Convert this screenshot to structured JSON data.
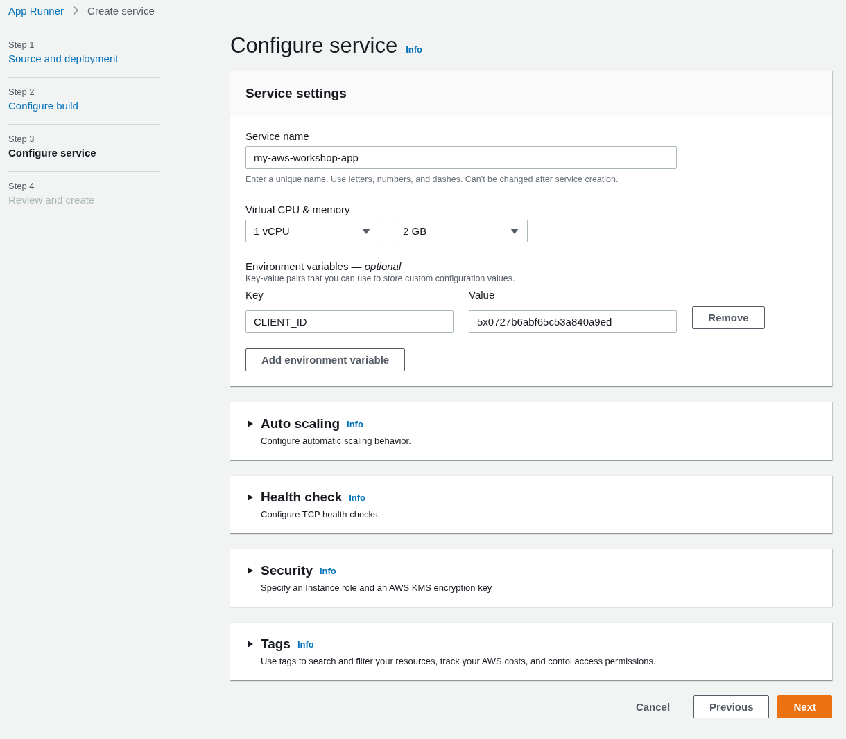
{
  "breadcrumb": [
    {
      "label": "App Runner",
      "kind": "link"
    },
    {
      "label": "Create service",
      "kind": "current"
    }
  ],
  "steps": [
    {
      "step": "Step 1",
      "label": "Source and deployment",
      "selected": false,
      "disabled": false
    },
    {
      "step": "Step 2",
      "label": "Configure build",
      "selected": false,
      "disabled": false
    },
    {
      "step": "Step 3",
      "label": "Configure service",
      "selected": true,
      "disabled": false
    },
    {
      "step": "Step 4",
      "label": "Review and create",
      "selected": false,
      "disabled": true
    }
  ],
  "page_title": "Configure service",
  "page_info": "Info",
  "service_settings": {
    "title": "Service settings",
    "service_name": {
      "label": "Service name",
      "value": "my-aws-workshop-app",
      "hint": "Enter a unique name. Use letters, numbers, and dashes. Can't be changed after service creation."
    },
    "cpu_memory": {
      "label": "Virtual CPU & memory",
      "cpu": "1 vCPU",
      "memory": "2 GB"
    },
    "env": {
      "label": "Environment variables — *optional*",
      "description": "Key-value pairs that you can use to store custom configuration values.",
      "key_label": "Key",
      "value_label": "Value",
      "rows": [
        {
          "key": "CLIENT_ID",
          "value": "5x0727b6abf65c53a840a9ed",
          "remove": "Remove"
        }
      ],
      "add_button": "Add environment variable"
    }
  },
  "sections": [
    {
      "title": "Auto scaling",
      "info": "Info",
      "description": "Configure automatic scaling behavior.",
      "expanded": false
    },
    {
      "title": "Health check",
      "info": "Info",
      "description": "Configure TCP health checks.",
      "expanded": false
    },
    {
      "title": "Security",
      "info": "Info",
      "description": "Specify an Instance role and an AWS KMS encryption key",
      "expanded": false
    },
    {
      "title": "Tags",
      "info": "Info",
      "description": "Use tags to search and filter your resources, track your AWS costs, and contol access permissions.",
      "expanded": false
    }
  ],
  "actions": {
    "cancel": "Cancel",
    "previous": "Previous",
    "next": "Next"
  }
}
